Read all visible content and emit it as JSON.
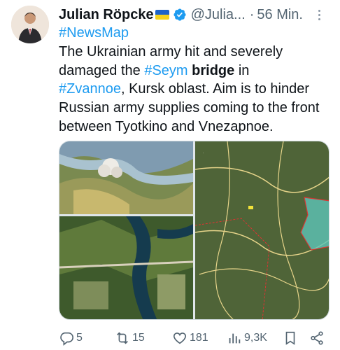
{
  "tweet": {
    "author_name": "Julian Röpcke",
    "handle": "@Julia...",
    "separator": "·",
    "time": "56 Min.",
    "text_parts": {
      "line1_tag": "#NewsMap",
      "p1": "The Ukrainian army hit and severely damaged the ",
      "tag_seym": "#Seym",
      "space": " ",
      "bridge": "bridge",
      "p2": " in",
      "tag_zvannoe": "#Zvannoe",
      "p3": ", Kursk oblast. Aim is to hinder Russian army supplies coming to the front between Tyotkino and Vnezapnoe."
    }
  },
  "actions": {
    "replies": "5",
    "retweets": "15",
    "likes": "181",
    "views": "9,3K"
  },
  "colors": {
    "link": "#1d9bf0",
    "muted": "#536471",
    "verified": "#1d9bf0"
  }
}
